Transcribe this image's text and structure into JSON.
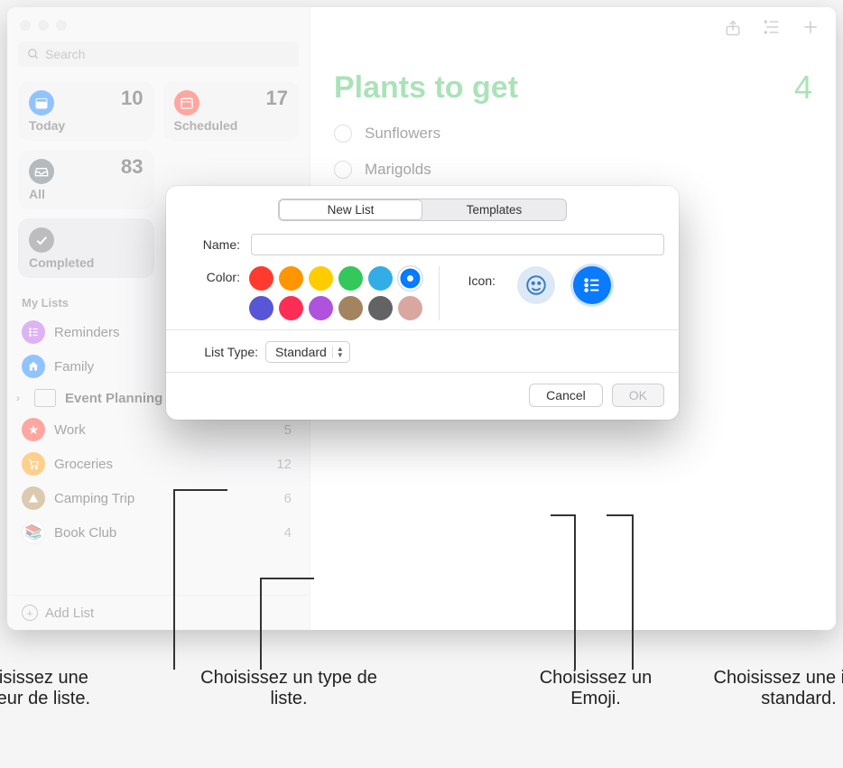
{
  "sidebar": {
    "search_placeholder": "Search",
    "smart": {
      "today": {
        "label": "Today",
        "count": "10"
      },
      "scheduled": {
        "label": "Scheduled",
        "count": "17"
      },
      "all": {
        "label": "All",
        "count": "83"
      },
      "completed": {
        "label": "Completed",
        "count": ""
      }
    },
    "section_title": "My Lists",
    "lists": [
      {
        "name": "Reminders",
        "count": "",
        "color": "#b657e5"
      },
      {
        "name": "Family",
        "count": "",
        "color": "#0a7aff"
      },
      {
        "name": "Event Planning",
        "count": "",
        "color": "#8a8a8e",
        "group": true
      },
      {
        "name": "Work",
        "count": "5",
        "color": "#ff3b30"
      },
      {
        "name": "Groceries",
        "count": "12",
        "color": "#ff9500"
      },
      {
        "name": "Camping Trip",
        "count": "6",
        "color": "#b08a50"
      },
      {
        "name": "Book Club",
        "count": "4",
        "color": "#34c759"
      }
    ],
    "add_list": "Add List"
  },
  "main": {
    "title": "Plants to get",
    "count": "4",
    "items": [
      "Sunflowers",
      "Marigolds"
    ]
  },
  "modal": {
    "tabs": {
      "new_list": "New List",
      "templates": "Templates"
    },
    "name_label": "Name:",
    "color_label": "Color:",
    "icon_label": "Icon:",
    "list_type_label": "List Type:",
    "list_type_value": "Standard",
    "cancel": "Cancel",
    "ok": "OK",
    "colors_row1": [
      "#ff3b30",
      "#ff9500",
      "#ffcc00",
      "#34c759",
      "#32ade6",
      "#007aff"
    ],
    "colors_row2": [
      "#5856d6",
      "#ff2d55",
      "#af52de",
      "#a2845e",
      "#636366",
      "#d9a7a0"
    ],
    "selected_color_index": 5
  },
  "callouts": {
    "c1": "Choisissez une couleur de liste.",
    "c2": "Choisissez un type de liste.",
    "c3": "Choisissez un Emoji.",
    "c4": "Choisissez une icône standard."
  }
}
